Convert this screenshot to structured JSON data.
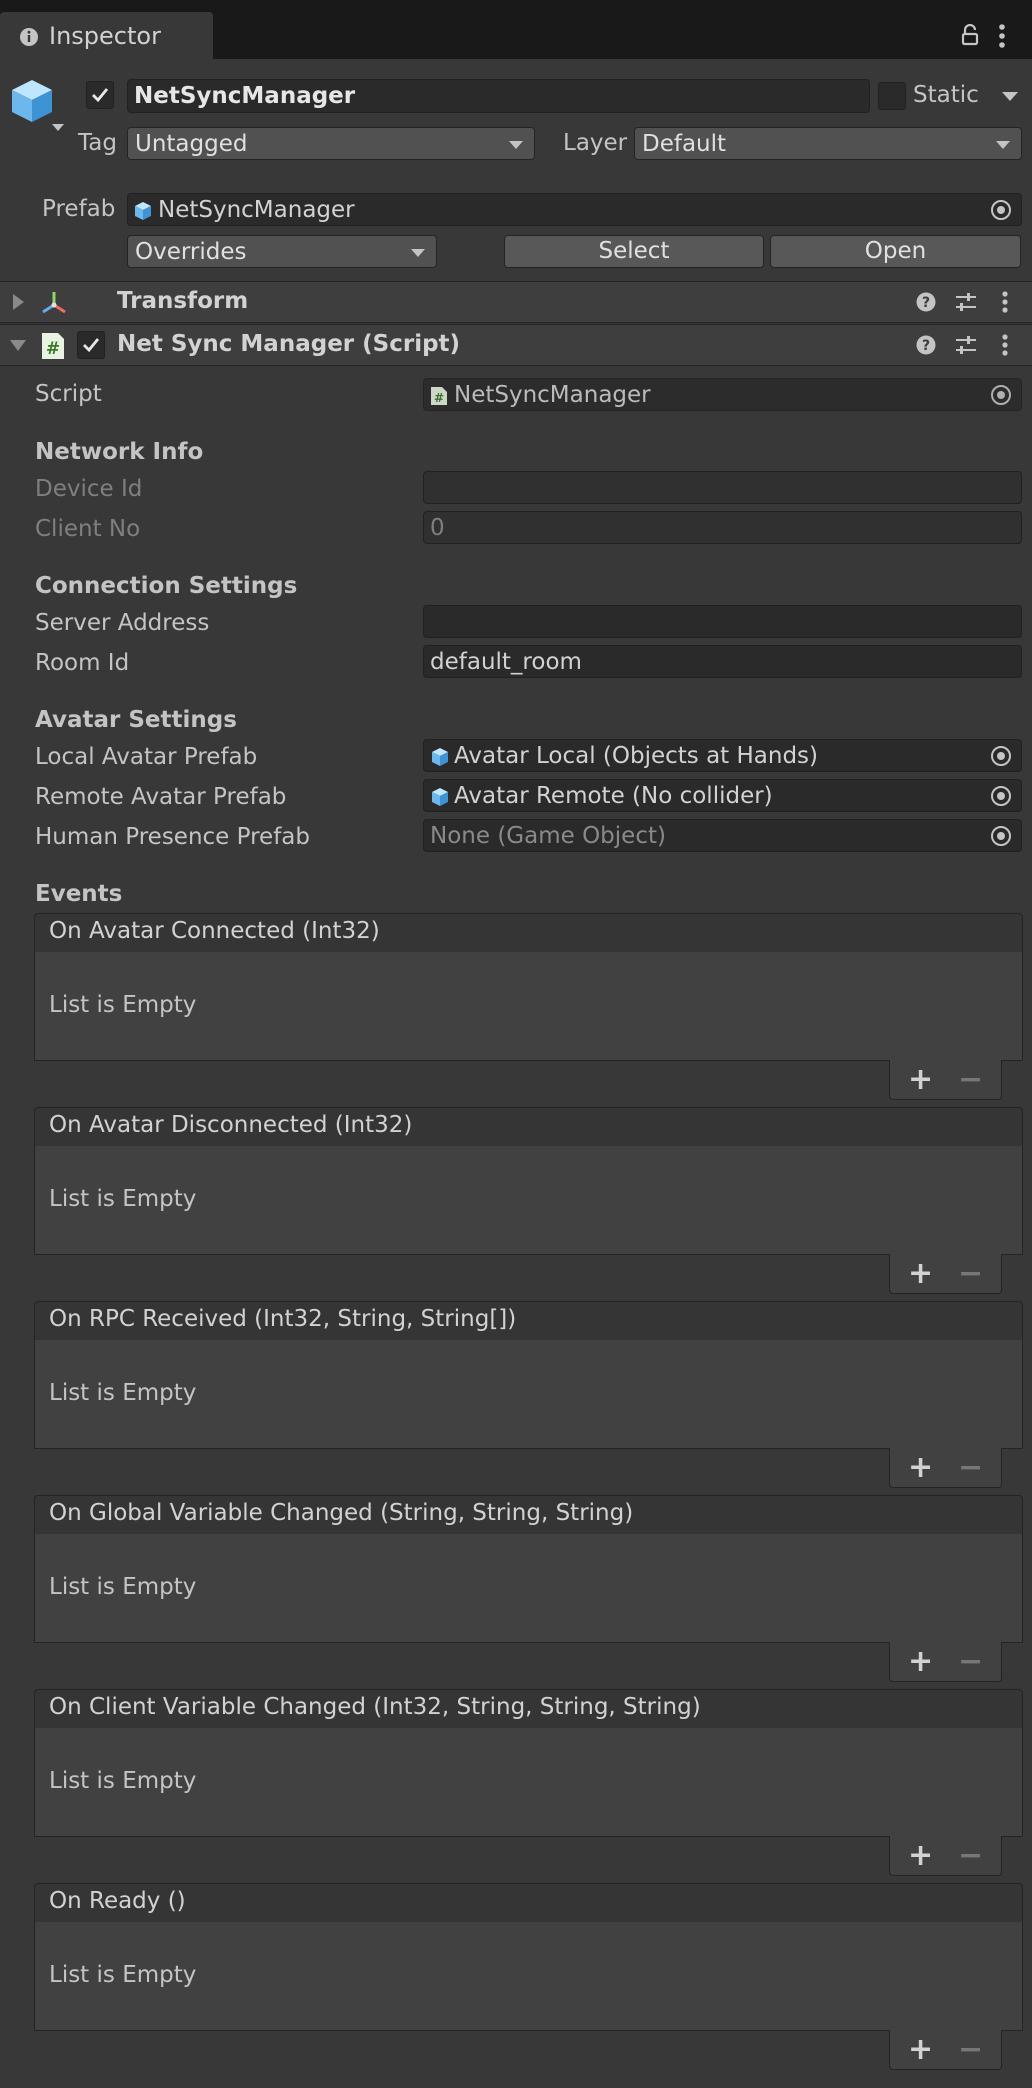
{
  "tab": {
    "label": "Inspector"
  },
  "object": {
    "name": "NetSyncManager",
    "active": true,
    "static_label": "Static",
    "tag_label": "Tag",
    "tag_value": "Untagged",
    "layer_label": "Layer",
    "layer_value": "Default"
  },
  "prefab": {
    "label": "Prefab",
    "value": "NetSyncManager",
    "overrides_label": "Overrides",
    "select_label": "Select",
    "open_label": "Open"
  },
  "components": {
    "transform": {
      "title": "Transform"
    },
    "script": {
      "title": "Net Sync Manager (Script)",
      "enabled": true
    }
  },
  "fields": {
    "script_label": "Script",
    "script_value": "NetSyncManager",
    "network_info_header": "Network Info",
    "device_id_label": "Device Id",
    "device_id_value": "",
    "client_no_label": "Client No",
    "client_no_value": "0",
    "connection_header": "Connection Settings",
    "server_address_label": "Server Address",
    "server_address_value": "",
    "room_id_label": "Room Id",
    "room_id_value": "default_room",
    "avatar_header": "Avatar Settings",
    "local_avatar_label": "Local Avatar Prefab",
    "local_avatar_value": "Avatar Local (Objects at Hands)",
    "remote_avatar_label": "Remote Avatar Prefab",
    "remote_avatar_value": "Avatar Remote (No collider)",
    "human_presence_label": "Human Presence Prefab",
    "human_presence_value": "None (Game Object)"
  },
  "events": {
    "header": "Events",
    "empty_label": "List is Empty",
    "plus": "+",
    "minus": "−",
    "items": [
      {
        "title": "On Avatar Connected (Int32)"
      },
      {
        "title": "On Avatar Disconnected (Int32)"
      },
      {
        "title": "On RPC Received (Int32, String, String[])"
      },
      {
        "title": "On Global Variable Changed (String, String, String)"
      },
      {
        "title": "On Client Variable Changed (Int32, String, String, String)"
      },
      {
        "title": "On Ready ()"
      }
    ]
  },
  "colors": {
    "background": "#383838",
    "tabbar": "#191919",
    "field": "#2a2a2a",
    "prefab_icon": "#7cc4f5",
    "script_icon": "#cfe8c5"
  },
  "icons": [
    "info-icon",
    "lock-icon",
    "kebab-menu-icon",
    "gameobject-cube-icon",
    "prefab-cube-icon",
    "transform-axis-icon",
    "script-hash-icon",
    "help-icon",
    "preset-sliders-icon",
    "object-picker-icon"
  ]
}
